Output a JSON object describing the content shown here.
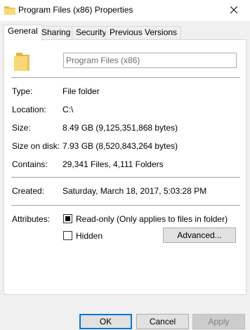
{
  "window": {
    "title": "Program Files (x86) Properties",
    "close_glyph": "✕",
    "title_icon": "folder-icon"
  },
  "tabs": [
    {
      "label": "General",
      "active": true
    },
    {
      "label": "Sharing",
      "active": false
    },
    {
      "label": "Security",
      "active": false
    },
    {
      "label": "Previous Versions",
      "active": false
    }
  ],
  "general": {
    "folder_icon": "folder-icon",
    "name_value": "Program Files (x86)",
    "type_label": "Type:",
    "type_value": "File folder",
    "location_label": "Location:",
    "location_value": "C:\\",
    "size_label": "Size:",
    "size_value": "8.49 GB (9,125,351,868 bytes)",
    "size_on_disk_label": "Size on disk:",
    "size_on_disk_value": "7.93 GB (8,520,843,264 bytes)",
    "contains_label": "Contains:",
    "contains_value": "29,341 Files, 4,111 Folders",
    "created_label": "Created:",
    "created_value": "Saturday, March 18, 2017, 5:03:28 PM",
    "attributes_label": "Attributes:",
    "readonly_label": "Read-only (Only applies to files in folder)",
    "readonly_state": "indeterminate",
    "hidden_label": "Hidden",
    "hidden_checked": false,
    "advanced_label": "Advanced..."
  },
  "footer": {
    "ok_label": "OK",
    "cancel_label": "Cancel",
    "apply_label": "Apply",
    "apply_enabled": false
  },
  "colors": {
    "folder_yellow": "#f8d775",
    "folder_dark": "#e0b84a",
    "focus_blue": "#0078d7"
  }
}
